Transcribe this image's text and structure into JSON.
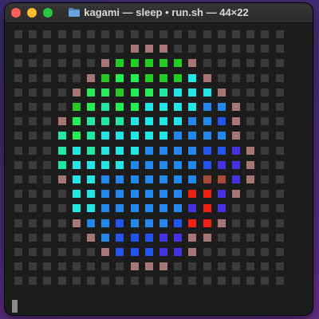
{
  "window": {
    "title": "kagami — sleep • run.sh — 44×22",
    "folder_icon": "folder-icon",
    "traffic_lights": {
      "close": "#fe5f57",
      "minimize": "#febc2e",
      "maximize": "#28c840"
    }
  },
  "terminal": {
    "grid_columns": 19,
    "grid_rows": 18,
    "legend": {
      ".": "#3b3b3b",
      "p": "#a87575",
      "g": "#22cc22",
      "G": "#22ee55",
      "t": "#20e8a0",
      "c": "#22e6e6",
      "b": "#2288ee",
      "B": "#2255f0",
      "v": "#4433e0",
      "r": "#ee2211",
      "m": "#a84a3a"
    },
    "rows": [
      "...................",
      "........ppp........",
      "......pgggggp......",
      ".....pgGGgggcp.....",
      "....pGGgGGtcccp....",
      "....gGtGGccccbbp...",
      "...pGtttccccbbBp...",
      "...tGtcccccbbbbp...",
      "...tctcccbbbbBBvp..",
      "...tccccbbbbbBvvp..",
      "...pccbbbbbbbmmvp..",
      "....ccbbbbbbrrvp...",
      "....ccbbbbbbvrv....",
      "....pbbBbbbBrrp....",
      ".....pbBBBvvpp.....",
      "......pBBBvvp......",
      "........ppp........",
      "..................."
    ]
  }
}
